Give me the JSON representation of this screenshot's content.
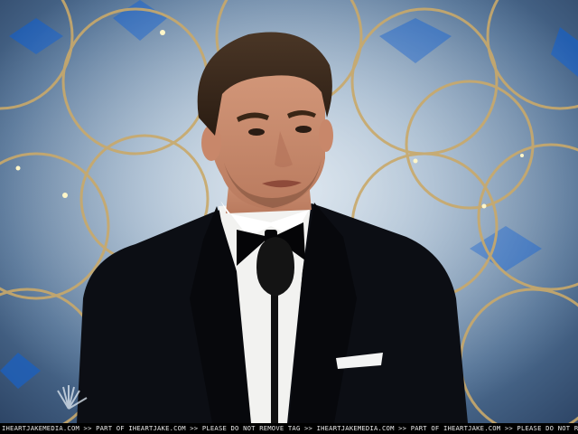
{
  "scene": {
    "description_tag": "award-show-podium",
    "backdrop_color": "#8ea7c0",
    "ring_color": "#c9a96a",
    "suit_color": "#0c0e14",
    "shirt_color": "#f2f2f0"
  },
  "broadcast": {
    "network_logo_icon": "peacock-logo-icon"
  },
  "watermark": {
    "text": "IHEARTJAKEMEDIA.COM >> PART OF IHEARTJAKE.COM >> PLEASE DO NOT REMOVE TAG >> IHEARTJAKEMEDIA.COM >> PART OF IHEARTJAKE.COM >> PLEASE DO NOT REMOVE TAG"
  }
}
